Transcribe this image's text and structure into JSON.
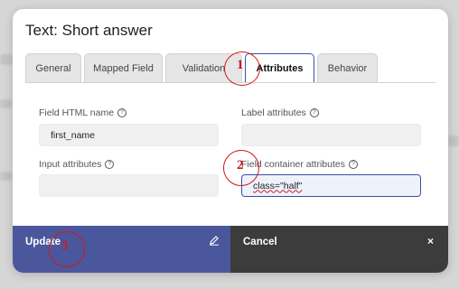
{
  "dialog": {
    "title": "Text: Short answer",
    "tabs": [
      {
        "label": "General"
      },
      {
        "label": "Mapped Field"
      },
      {
        "label": "Validation"
      },
      {
        "label": "Attributes"
      },
      {
        "label": "Behavior"
      }
    ],
    "active_tab": "Attributes",
    "fields": {
      "html_name": {
        "label": "Field HTML name",
        "value": "first_name"
      },
      "label_attributes": {
        "label": "Label attributes",
        "value": ""
      },
      "input_attributes": {
        "label": "Input attributes",
        "value": ""
      },
      "container_attributes": {
        "label": "Field container attributes",
        "value": "class=\"half\""
      }
    },
    "footer": {
      "update_label": "Update",
      "cancel_label": "Cancel",
      "close_glyph": "×"
    }
  },
  "annotations": [
    {
      "number": "1"
    },
    {
      "number": "2"
    },
    {
      "number": "3"
    }
  ],
  "colors": {
    "accent": "#3a4fa6",
    "update_bg": "#4b579c",
    "cancel_bg": "#3c3c3c",
    "annotation": "#d01818"
  }
}
